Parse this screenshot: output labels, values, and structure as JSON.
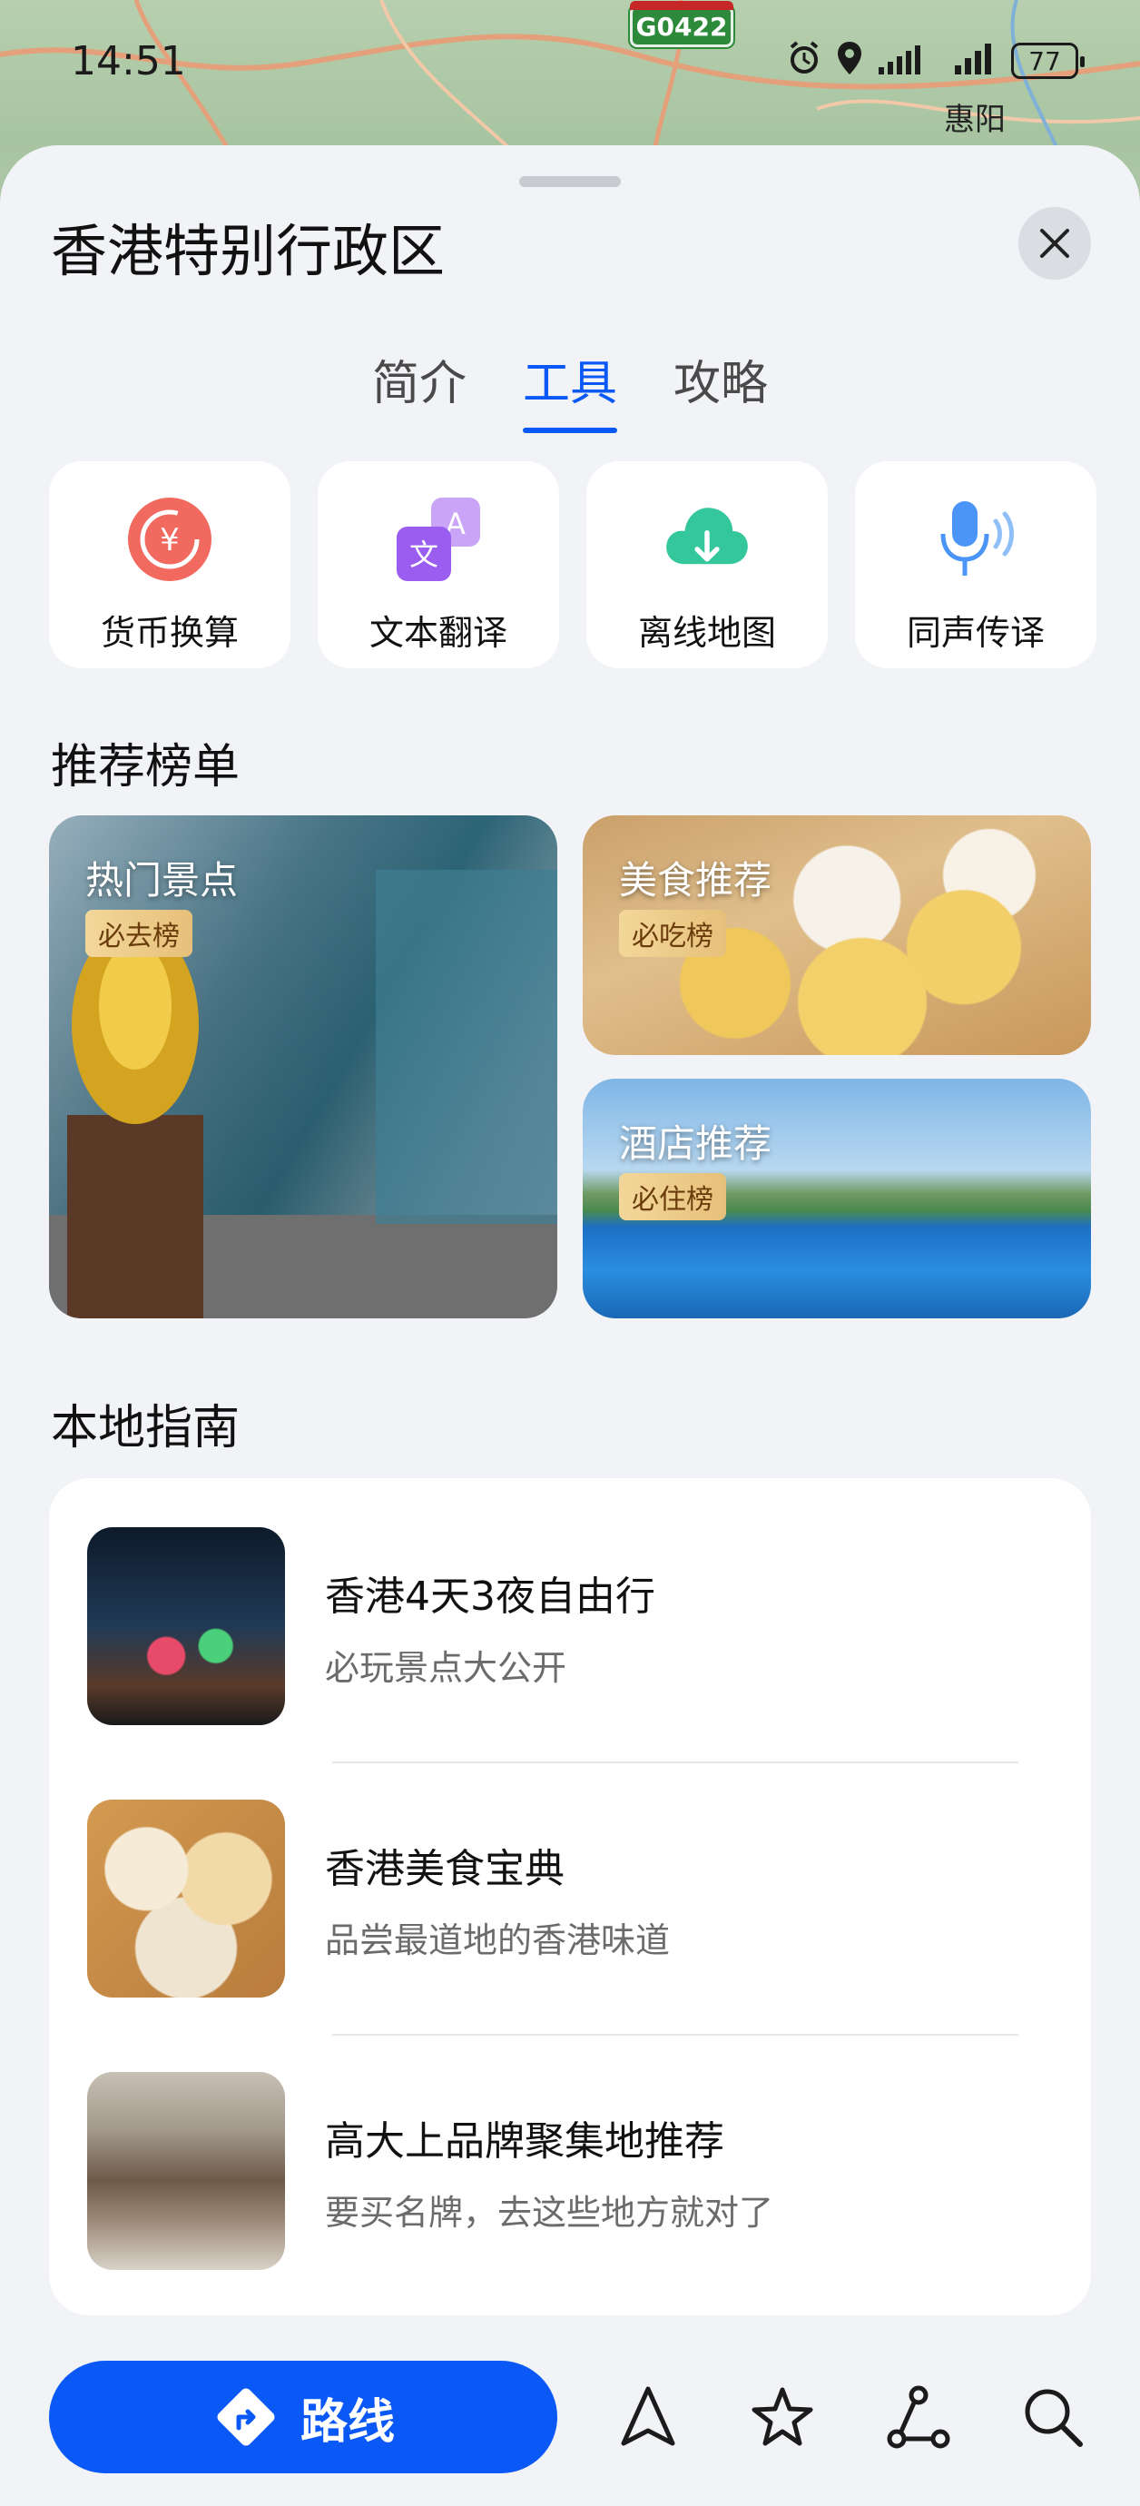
{
  "status_bar": {
    "time": "14:51",
    "battery": "77",
    "map_place_label": "惠阳",
    "road_shield": "G0422"
  },
  "sheet": {
    "title": "香港特别行政区",
    "tabs": [
      {
        "label": "简介",
        "active": false
      },
      {
        "label": "工具",
        "active": true
      },
      {
        "label": "攻略",
        "active": false
      }
    ]
  },
  "tools": [
    {
      "label": "货币换算",
      "icon": "currency-exchange-icon",
      "color": "#ef5350"
    },
    {
      "label": "文本翻译",
      "icon": "translate-icon",
      "color": "#a066f0"
    },
    {
      "label": "离线地图",
      "icon": "offline-map-download-icon",
      "color": "#2fc59a"
    },
    {
      "label": "同声传译",
      "icon": "microphone-icon",
      "color": "#3c8df5"
    }
  ],
  "recommend": {
    "section_title": "推荐榜单",
    "cards": [
      {
        "title": "热门景点",
        "badge": "必去榜"
      },
      {
        "title": "美食推荐",
        "badge": "必吃榜"
      },
      {
        "title": "酒店推荐",
        "badge": "必住榜"
      }
    ]
  },
  "guide": {
    "section_title": "本地指南",
    "items": [
      {
        "title": "香港4天3夜自由行",
        "subtitle": "必玩景点大公开"
      },
      {
        "title": "香港美食宝典",
        "subtitle": "品尝最道地的香港味道"
      },
      {
        "title": "高大上品牌聚集地推荐",
        "subtitle": "要买名牌，去这些地方就对了"
      }
    ]
  },
  "bottom_bar": {
    "route_label": "路线",
    "icons": [
      "navigation-icon",
      "favorite-star-icon",
      "route-plan-icon",
      "search-icon"
    ]
  },
  "colors": {
    "accent": "#0a59f7",
    "sheet_bg": "#f1f3f6"
  }
}
